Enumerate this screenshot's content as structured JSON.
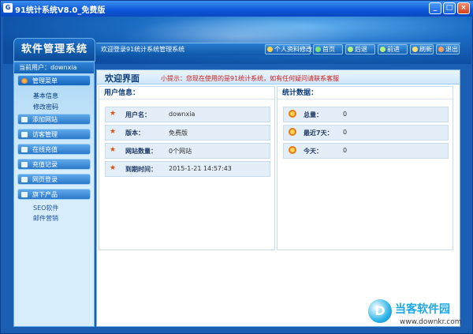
{
  "window": {
    "title": "91统计系统V8.0_免费版",
    "app_icon": "G"
  },
  "window_controls": {
    "min": "_",
    "max": "□",
    "close": "×"
  },
  "logo": "软件管理系统",
  "navbar": {
    "welcome": "欢迎登录91统计系统管理系统",
    "buttons": [
      "个人资料修改",
      "首页",
      "后退",
      "前进",
      "刷新",
      "退出"
    ]
  },
  "sidebar": {
    "current_user": "当前用户：downxia",
    "menus": [
      {
        "label": "管理菜单",
        "subs": [
          "基本信息",
          "修改密码"
        ]
      },
      {
        "label": "添加网站",
        "subs": []
      },
      {
        "label": "访客管理",
        "subs": []
      },
      {
        "label": "在线充值",
        "subs": []
      },
      {
        "label": "充值记录",
        "subs": []
      },
      {
        "label": "网页登录",
        "subs": []
      },
      {
        "label": "旗下产品",
        "subs": [
          "SEO软件",
          "邮件营销"
        ]
      }
    ]
  },
  "main": {
    "title": "欢迎界面",
    "tip": "小提示：您现在使用的是91统计系统，如有任何疑问请联系客服",
    "user_panel": {
      "heading": "用户信息：",
      "rows": [
        {
          "label": "用户名：",
          "value": "downxia"
        },
        {
          "label": "版本：",
          "value": "免费版"
        },
        {
          "label": "网站数量：",
          "value": "0个网站"
        },
        {
          "label": "到期时间：",
          "value": "2015-1-21 14:57:43"
        }
      ]
    },
    "stats_panel": {
      "heading": "统计数据：",
      "rows": [
        {
          "label": "总量：",
          "value": "0"
        },
        {
          "label": "最近7天：",
          "value": "0"
        },
        {
          "label": "今天：",
          "value": "0"
        }
      ]
    }
  },
  "watermark": {
    "brand": "当客软件园",
    "url": "www.downkr.com",
    "logo": "D"
  }
}
